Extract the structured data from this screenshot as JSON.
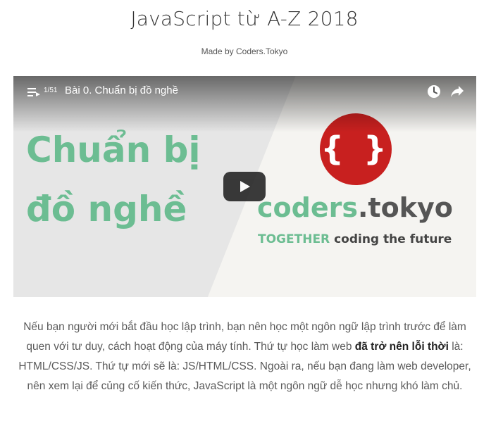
{
  "page": {
    "title": "JavaScript từ A-Z 2018",
    "subtitle": "Made by Coders.Tokyo"
  },
  "video": {
    "playlist_icon": "playlist-icon",
    "playlist_count": "1/51",
    "title": "Bài 0. Chuẩn bị đồ nghề",
    "watch_later_icon": "clock-icon",
    "share_icon": "share-icon",
    "play_icon": "play-icon",
    "thumbnail": {
      "line1": "Chuẩn bị",
      "line2": "đồ nghề",
      "logo_text": "{ }",
      "brand_part1": "coders",
      "brand_part2": ".tokyo",
      "slogan_part1": "TOGETHER",
      "slogan_part2": " coding the future"
    },
    "colors": {
      "green": "#6cbd92",
      "logo_red": "#c8201f",
      "play_bg": "#212121"
    }
  },
  "description": {
    "part1": "Nếu bạn người mới bắt đầu học lập trình, bạn nên học một ngôn ngữ lập trình trước để làm quen với tư duy, cách hoạt động của máy tính. Thứ tự học làm web ",
    "bold": "đã trở nên lỗi thời",
    "part2": " là: HTML/CSS/JS. Thứ tự mới sẽ là: JS/HTML/CSS. Ngoài ra, nếu bạn đang làm web developer, nên xem lại để củng cố kiến thức, JavaScript là một ngôn ngữ dễ học nhưng khó làm chủ."
  }
}
